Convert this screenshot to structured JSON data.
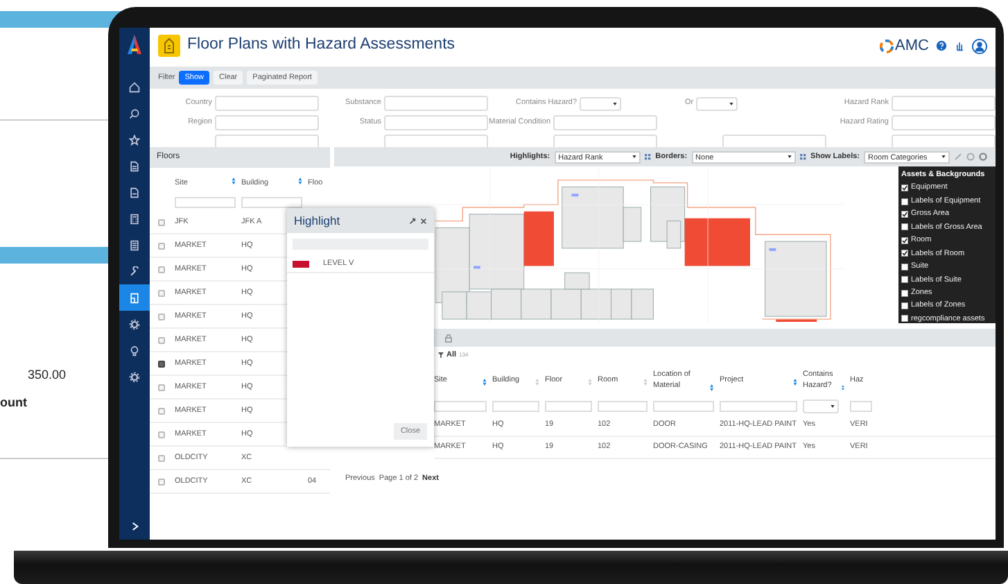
{
  "background": {
    "texts": [
      {
        "text": "350.00",
        "bold": false
      },
      {
        "text": "ount",
        "bold": true
      }
    ]
  },
  "sidebar": {
    "items": [
      {
        "selected": false
      },
      {
        "selected": false
      },
      {
        "selected": false
      },
      {
        "selected": false
      },
      {
        "selected": false
      },
      {
        "selected": false
      },
      {
        "selected": false
      },
      {
        "selected": false
      },
      {
        "selected": true
      },
      {
        "selected": false
      },
      {
        "selected": false
      },
      {
        "selected": false
      }
    ]
  },
  "header": {
    "title": "Floor Plans with Hazard Assessments",
    "brand": "AMC"
  },
  "filter": {
    "label": "Filter",
    "buttons": [
      {
        "label": "Show",
        "kind": "primary"
      },
      {
        "label": "Clear",
        "kind": "secondary"
      },
      {
        "label": "Paginated Report",
        "kind": "secondary"
      }
    ],
    "rows": [
      [
        {
          "label": "Country",
          "kind": "text"
        },
        {
          "label": "Substance",
          "kind": "text"
        },
        {
          "label": "Contains Hazard?",
          "kind": "select"
        },
        {
          "label": "Or",
          "kind": "select"
        },
        {
          "label": "Hazard Rank",
          "kind": "text"
        }
      ],
      [
        {
          "label": "Region",
          "kind": "text"
        },
        {
          "label": "Status",
          "kind": "text"
        },
        {
          "label": "Material Condition",
          "kind": "text"
        },
        {
          "kind": "none"
        },
        {
          "label": "Hazard Rating",
          "kind": "text"
        }
      ]
    ]
  },
  "floors": {
    "title": "Floors",
    "columns": [
      "Site",
      "Building",
      "Floo"
    ],
    "rows": [
      {
        "site": "JFK",
        "building": "JFK A",
        "checked": false
      },
      {
        "site": "MARKET",
        "building": "HQ",
        "checked": false
      },
      {
        "site": "MARKET",
        "building": "HQ",
        "checked": false
      },
      {
        "site": "MARKET",
        "building": "HQ",
        "checked": false
      },
      {
        "site": "MARKET",
        "building": "HQ",
        "checked": false
      },
      {
        "site": "MARKET",
        "building": "HQ",
        "checked": false
      },
      {
        "site": "MARKET",
        "building": "HQ",
        "checked": true
      },
      {
        "site": "MARKET",
        "building": "HQ",
        "checked": false
      },
      {
        "site": "MARKET",
        "building": "HQ",
        "checked": false
      },
      {
        "site": "MARKET",
        "building": "HQ",
        "checked": false
      },
      {
        "site": "OLDCITY",
        "building": "XC",
        "checked": false
      },
      {
        "site": "OLDCITY",
        "building": "XC",
        "floor": "04",
        "checked": false
      }
    ]
  },
  "map": {
    "toolbar": [
      {
        "label": "Highlights:",
        "value": "Hazard Rank"
      },
      {
        "label": "Borders:",
        "value": "None"
      },
      {
        "label": "Show Labels:",
        "value": "Room Categories"
      }
    ],
    "legend": {
      "title": "Assets & Backgrounds",
      "items": [
        {
          "label": "Equipment",
          "checked": true
        },
        {
          "label": "Labels of Equipment",
          "checked": false
        },
        {
          "label": "Gross Area",
          "checked": true
        },
        {
          "label": "Labels of Gross Area",
          "checked": false
        },
        {
          "label": "Room",
          "checked": true
        },
        {
          "label": "Labels of Room",
          "checked": true
        },
        {
          "label": "Suite",
          "checked": false
        },
        {
          "label": "Labels of Suite",
          "checked": false
        },
        {
          "label": "Zones",
          "checked": false
        },
        {
          "label": "Labels of Zones",
          "checked": false
        },
        {
          "label": "regcompliance assets",
          "checked": false
        }
      ]
    }
  },
  "results": {
    "filter_label": "All",
    "count": "134",
    "columns": [
      "Site",
      "Building",
      "Floor",
      "Room",
      "Location of Material",
      "Project",
      "Contains Hazard?",
      "Haz"
    ],
    "rows": [
      [
        "MARKET",
        "HQ",
        "19",
        "102",
        "DOOR",
        "2011-HQ-LEAD PAINT",
        "Yes",
        "VERI"
      ],
      [
        "MARKET",
        "HQ",
        "19",
        "102",
        "DOOR-CASING",
        "2011-HQ-LEAD PAINT",
        "Yes",
        "VERI"
      ]
    ],
    "pagination": {
      "previous": "Previous",
      "page": "Page 1 of 2",
      "next": "Next"
    }
  },
  "highlight_dialog": {
    "title": "Highlight",
    "items": [
      {
        "label": "LEVEL V",
        "color": "#c8102e"
      }
    ],
    "close": "Close"
  }
}
